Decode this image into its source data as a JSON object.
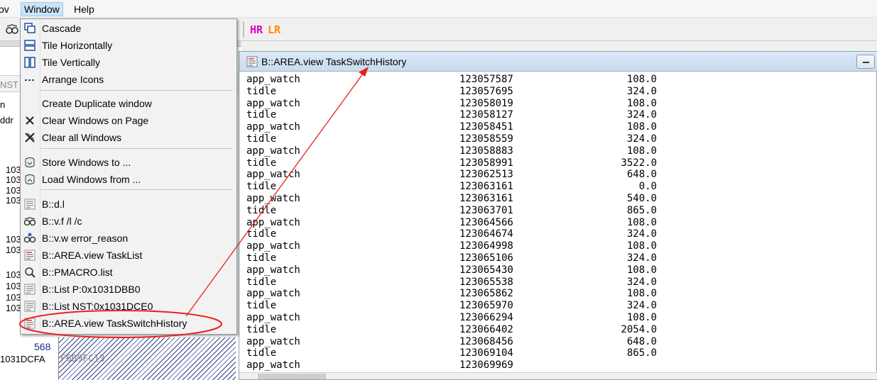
{
  "menubar": {
    "items": [
      {
        "label": "ov"
      },
      {
        "label": "Window"
      },
      {
        "label": "Help"
      }
    ]
  },
  "toolbar": {
    "hr_label": "HR",
    "lr_label": "LR"
  },
  "left_window": {
    "texts": [
      {
        "text": "NST"
      },
      {
        "text": "n"
      },
      {
        "text": "ddr"
      },
      {
        "text": "103"
      },
      {
        "text": "103"
      },
      {
        "text": "103"
      },
      {
        "text": "103"
      },
      {
        "text": "103"
      },
      {
        "text": "103"
      },
      {
        "text": "103"
      },
      {
        "text": "103"
      },
      {
        "text": "103"
      },
      {
        "text": "103"
      },
      {
        "text": "568"
      },
      {
        "text": "1031DCFA"
      },
      {
        "text": "F6D9FC13"
      }
    ]
  },
  "window_menu": {
    "items": [
      {
        "label": "Cascade",
        "icon": "cascade-icon"
      },
      {
        "label": "Tile Horizontally",
        "icon": "tile-horizontal-icon"
      },
      {
        "label": "Tile Vertically",
        "icon": "tile-vertical-icon"
      },
      {
        "label": "Arrange Icons",
        "icon": "arrange-icons-icon"
      },
      {
        "label": "Create Duplicate window",
        "icon": ""
      },
      {
        "label": "Clear Windows on Page",
        "icon": "close-icon"
      },
      {
        "label": "Clear all Windows",
        "icon": "clear-all-icon"
      },
      {
        "label": "Store Windows to ...",
        "icon": "store-windows-icon"
      },
      {
        "label": "Load Windows from ...",
        "icon": "load-windows-icon"
      },
      {
        "label": "B::d.l",
        "icon": "list-icon"
      },
      {
        "label": "B::v.f /l /c",
        "icon": "glasses-icon"
      },
      {
        "label": "B::v.w error_reason",
        "icon": "watch-icon"
      },
      {
        "label": "B::AREA.view TaskList",
        "icon": "area-view-icon"
      },
      {
        "label": "B::PMACRO.list",
        "icon": "magnifier-icon"
      },
      {
        "label": "B::List P:0x1031DBB0",
        "icon": "list-icon"
      },
      {
        "label": "B::List NST:0x1031DCE0",
        "icon": "list-icon"
      },
      {
        "label": "B::AREA.view TaskSwitchHistory",
        "icon": "area-view-icon"
      }
    ]
  },
  "area_window": {
    "title": "B::AREA.view TaskSwitchHistory",
    "rows": [
      {
        "task": "app_watch",
        "time": "123057587",
        "duration": "108.0"
      },
      {
        "task": "tidle",
        "time": "123057695",
        "duration": "324.0"
      },
      {
        "task": "app_watch",
        "time": "123058019",
        "duration": "108.0"
      },
      {
        "task": "tidle",
        "time": "123058127",
        "duration": "324.0"
      },
      {
        "task": "app_watch",
        "time": "123058451",
        "duration": "108.0"
      },
      {
        "task": "tidle",
        "time": "123058559",
        "duration": "324.0"
      },
      {
        "task": "app_watch",
        "time": "123058883",
        "duration": "108.0"
      },
      {
        "task": "tidle",
        "time": "123058991",
        "duration": "3522.0"
      },
      {
        "task": "app_watch",
        "time": "123062513",
        "duration": "648.0"
      },
      {
        "task": "tidle",
        "time": "123063161",
        "duration": "0.0"
      },
      {
        "task": "app_watch",
        "time": "123063161",
        "duration": "540.0"
      },
      {
        "task": "tidle",
        "time": "123063701",
        "duration": "865.0"
      },
      {
        "task": "app_watch",
        "time": "123064566",
        "duration": "108.0"
      },
      {
        "task": "tidle",
        "time": "123064674",
        "duration": "324.0"
      },
      {
        "task": "app_watch",
        "time": "123064998",
        "duration": "108.0"
      },
      {
        "task": "tidle",
        "time": "123065106",
        "duration": "324.0"
      },
      {
        "task": "app_watch",
        "time": "123065430",
        "duration": "108.0"
      },
      {
        "task": "tidle",
        "time": "123065538",
        "duration": "324.0"
      },
      {
        "task": "app_watch",
        "time": "123065862",
        "duration": "108.0"
      },
      {
        "task": "tidle",
        "time": "123065970",
        "duration": "324.0"
      },
      {
        "task": "app_watch",
        "time": "123066294",
        "duration": "108.0"
      },
      {
        "task": "tidle",
        "time": "123066402",
        "duration": "2054.0"
      },
      {
        "task": "app_watch",
        "time": "123068456",
        "duration": "648.0"
      },
      {
        "task": "tidle",
        "time": "123069104",
        "duration": "865.0"
      },
      {
        "task": "app_watch",
        "time": "123069969",
        "duration": ""
      }
    ]
  },
  "colors": {
    "menu_highlight": "#cce4f7",
    "annotation_red": "#e8201e",
    "hr_color": "#e000c8",
    "lr_color": "#ff8c00"
  }
}
